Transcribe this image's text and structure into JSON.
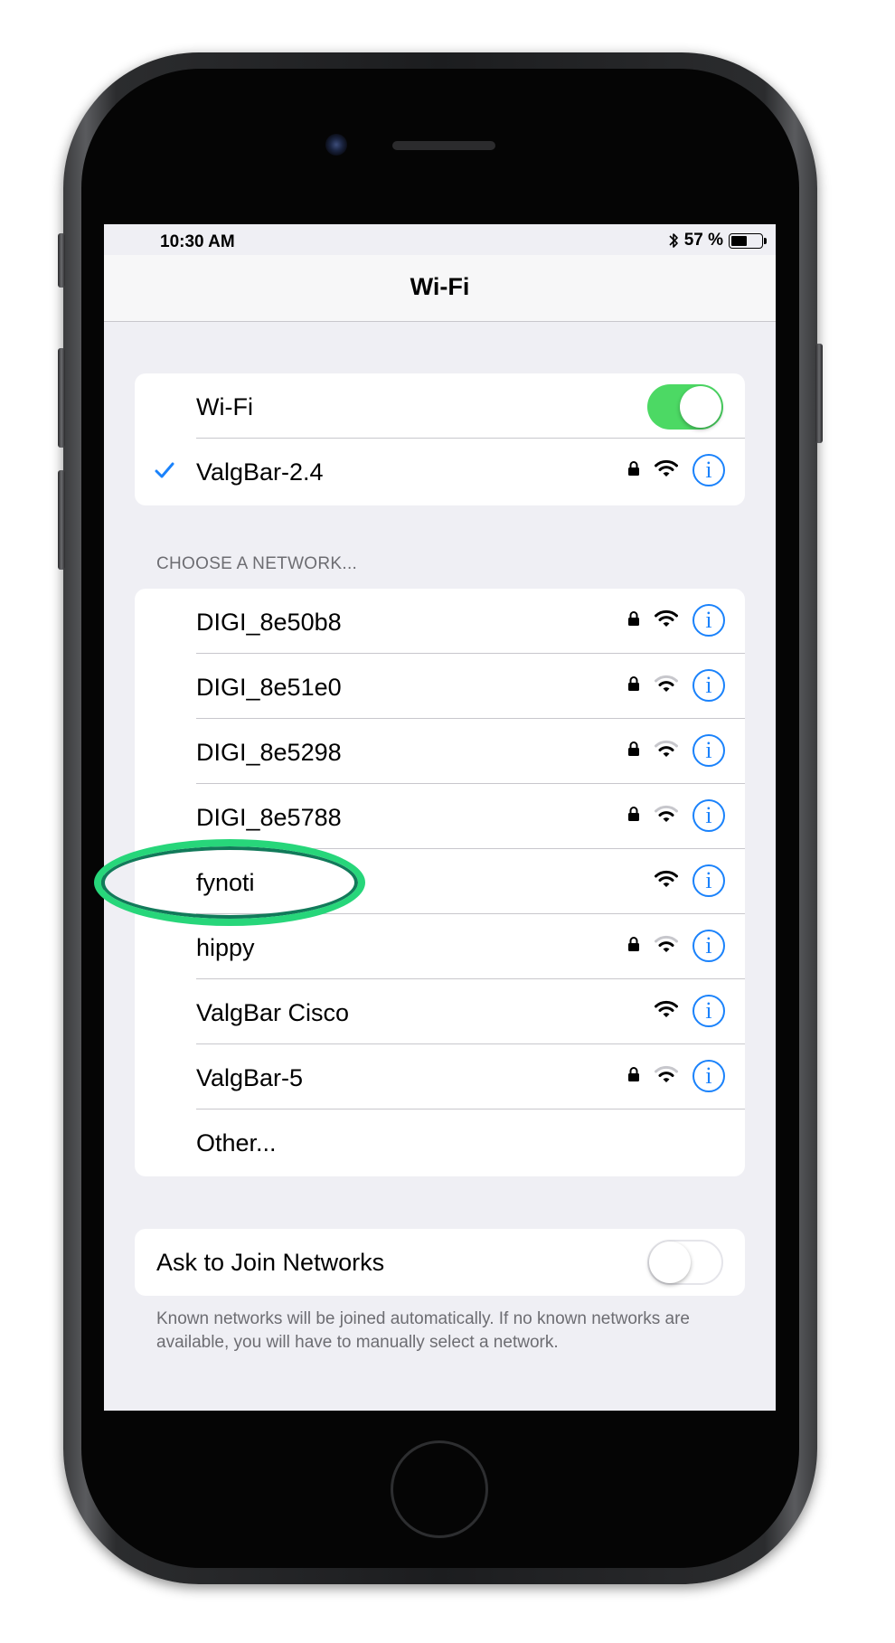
{
  "status_bar": {
    "time": "10:30 AM",
    "battery_text": "57 %",
    "battery_level": 0.57,
    "bluetooth_icon": "bluetooth-icon"
  },
  "nav": {
    "title": "Wi-Fi"
  },
  "wifi": {
    "label": "Wi-Fi",
    "enabled": true
  },
  "connected": {
    "name": "ValgBar-2.4",
    "locked": true,
    "signal": "full"
  },
  "section_header": "CHOOSE A NETWORK...",
  "networks": [
    {
      "name": "DIGI_8e50b8",
      "locked": true,
      "signal": "full"
    },
    {
      "name": "DIGI_8e51e0",
      "locked": true,
      "signal": "partial"
    },
    {
      "name": "DIGI_8e5298",
      "locked": true,
      "signal": "partial"
    },
    {
      "name": "DIGI_8e5788",
      "locked": true,
      "signal": "partial"
    },
    {
      "name": "fynoti",
      "locked": false,
      "signal": "full"
    },
    {
      "name": "hippy",
      "locked": true,
      "signal": "partial"
    },
    {
      "name": "ValgBar Cisco",
      "locked": false,
      "signal": "full"
    },
    {
      "name": "ValgBar-5",
      "locked": true,
      "signal": "partial"
    }
  ],
  "other_label": "Other...",
  "ask_to_join": {
    "label": "Ask to Join Networks",
    "enabled": false
  },
  "footer": "Known networks will be joined automatically. If no known networks are available, you will have to manually select a network.",
  "colors": {
    "accent": "#1a82fb",
    "toggle_on": "#4cd964",
    "highlight": "#27d67a",
    "background": "#efeff4"
  },
  "icons": {
    "lock": "lock-icon",
    "wifi": "wifi-icon",
    "info": "info-icon",
    "check": "checkmark-icon"
  }
}
